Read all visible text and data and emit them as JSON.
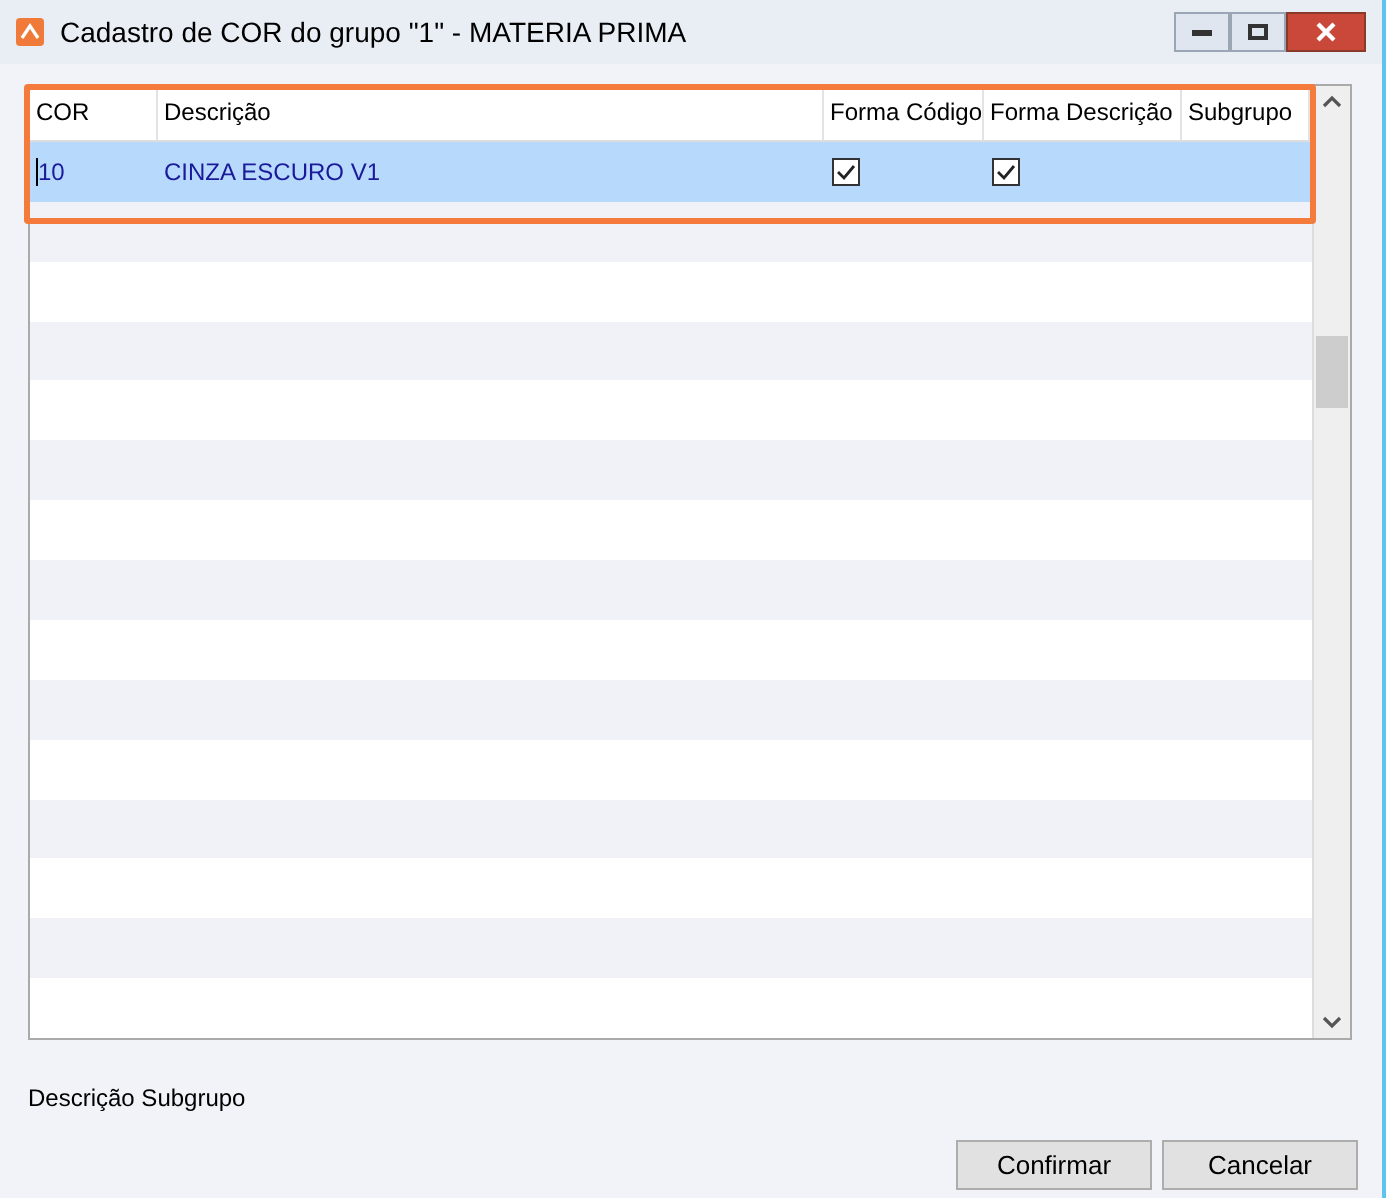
{
  "window": {
    "title": "Cadastro de COR do grupo \"1\" - MATERIA PRIMA"
  },
  "table": {
    "columns": [
      "COR",
      "Descrição",
      "Forma Código",
      "Forma Descrição",
      "Subgrupo"
    ],
    "rows": [
      {
        "cor": "10",
        "descricao": "CINZA ESCURO V1",
        "forma_codigo": true,
        "forma_descricao": true,
        "selected": true
      }
    ]
  },
  "footer_label": "Descrição Subgrupo",
  "buttons": [
    "Confirmar",
    "Cancelar"
  ]
}
